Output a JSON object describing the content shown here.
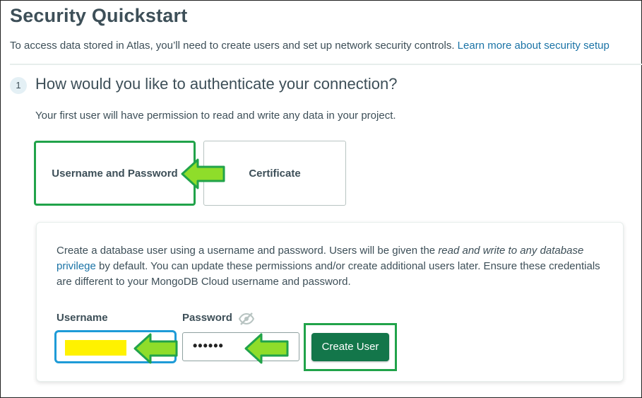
{
  "header": {
    "title": "Security Quickstart",
    "intro_text": "To access data stored in Atlas, you’ll need to create users and set up network security controls. ",
    "learn_more_link": "Learn more about security setup"
  },
  "step": {
    "number": "1",
    "title": "How would you like to authenticate your connection?",
    "subtitle": "Your first user will have permission to read and write any data in your project."
  },
  "auth_options": {
    "selected": "Username and Password",
    "option_1": "Username and Password",
    "option_2": "Certificate"
  },
  "panel": {
    "text_part1": "Create a database user using a username and password. Users will be given the ",
    "text_italic": "read and write to any database",
    "text_link": "privilege",
    "text_part2": " by default. You can update these permissions and/or create additional users later. Ensure these credentials are different to your MongoDB Cloud username and password.",
    "username_label": "Username",
    "password_label": "Password",
    "password_value": "••••••",
    "create_button": "Create User"
  },
  "colors": {
    "highlight_green": "#21a34a",
    "arrow_fill": "#8fdd2a",
    "button_green": "#13764a",
    "username_focus": "#1e9bd7",
    "redacted_fill": "#fff200"
  },
  "icons": {
    "password_visibility": "eye-slash-icon",
    "annotation": "arrow-left-icon"
  }
}
